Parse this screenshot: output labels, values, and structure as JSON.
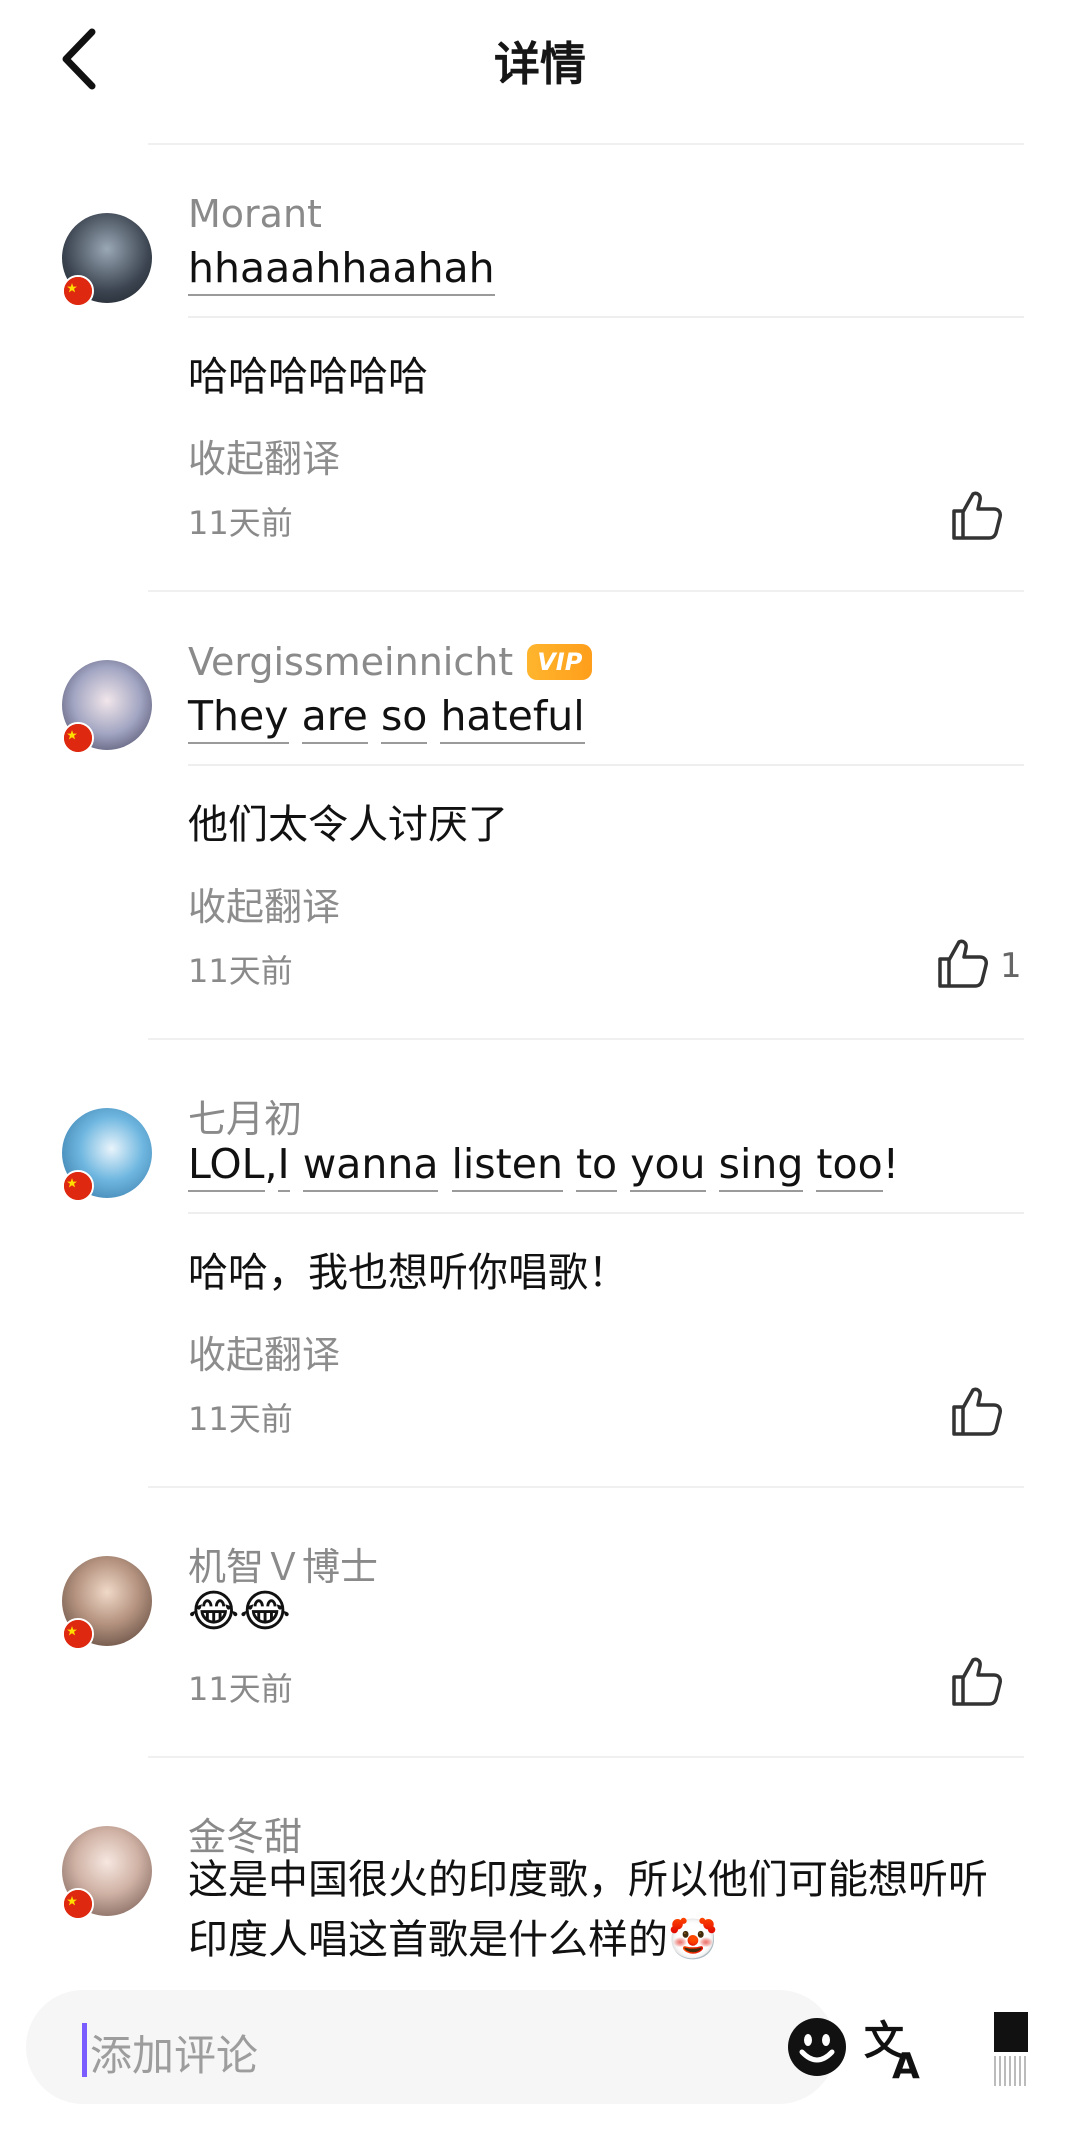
{
  "header": {
    "title": "详情"
  },
  "comments": [
    {
      "username": "Morant",
      "original": [
        "hhaaahhaahah"
      ],
      "translated": "哈哈哈哈哈哈",
      "collapse_label": "收起翻译",
      "time": "11天前",
      "likes": ""
    },
    {
      "username": "Vergissmeinnicht",
      "badge": "VIP",
      "original": [
        "They",
        "are",
        "so",
        "hateful"
      ],
      "translated": "他们太令人讨厌了",
      "collapse_label": "收起翻译",
      "time": "11天前",
      "likes": "1"
    },
    {
      "username": "七月初",
      "original": [
        "LOL",
        ",",
        "I",
        "wanna",
        "listen",
        "to",
        "you",
        "sing",
        "too",
        "!"
      ],
      "translated": "哈哈，我也想听你唱歌！",
      "collapse_label": "收起翻译",
      "time": "11天前",
      "likes": ""
    },
    {
      "username": "机智Ｖ博士",
      "text": "😂😂",
      "time": "11天前",
      "likes": ""
    },
    {
      "username": "金冬甜",
      "text_line1": "这是中国很火的印度歌，所以他们可能想听听",
      "text_line2": "印度人唱这首歌是什么样的🤡"
    }
  ],
  "input": {
    "placeholder": "添加评论"
  },
  "icons": {
    "back": "chevron-left-icon",
    "like": "thumbs-up-icon",
    "emoji": "smiley-icon",
    "translate": "translate-icon",
    "flag": "china-flag-icon"
  },
  "colors": {
    "vip": "#ffab25",
    "caret": "#7b5cff",
    "flag": "#de2910"
  }
}
